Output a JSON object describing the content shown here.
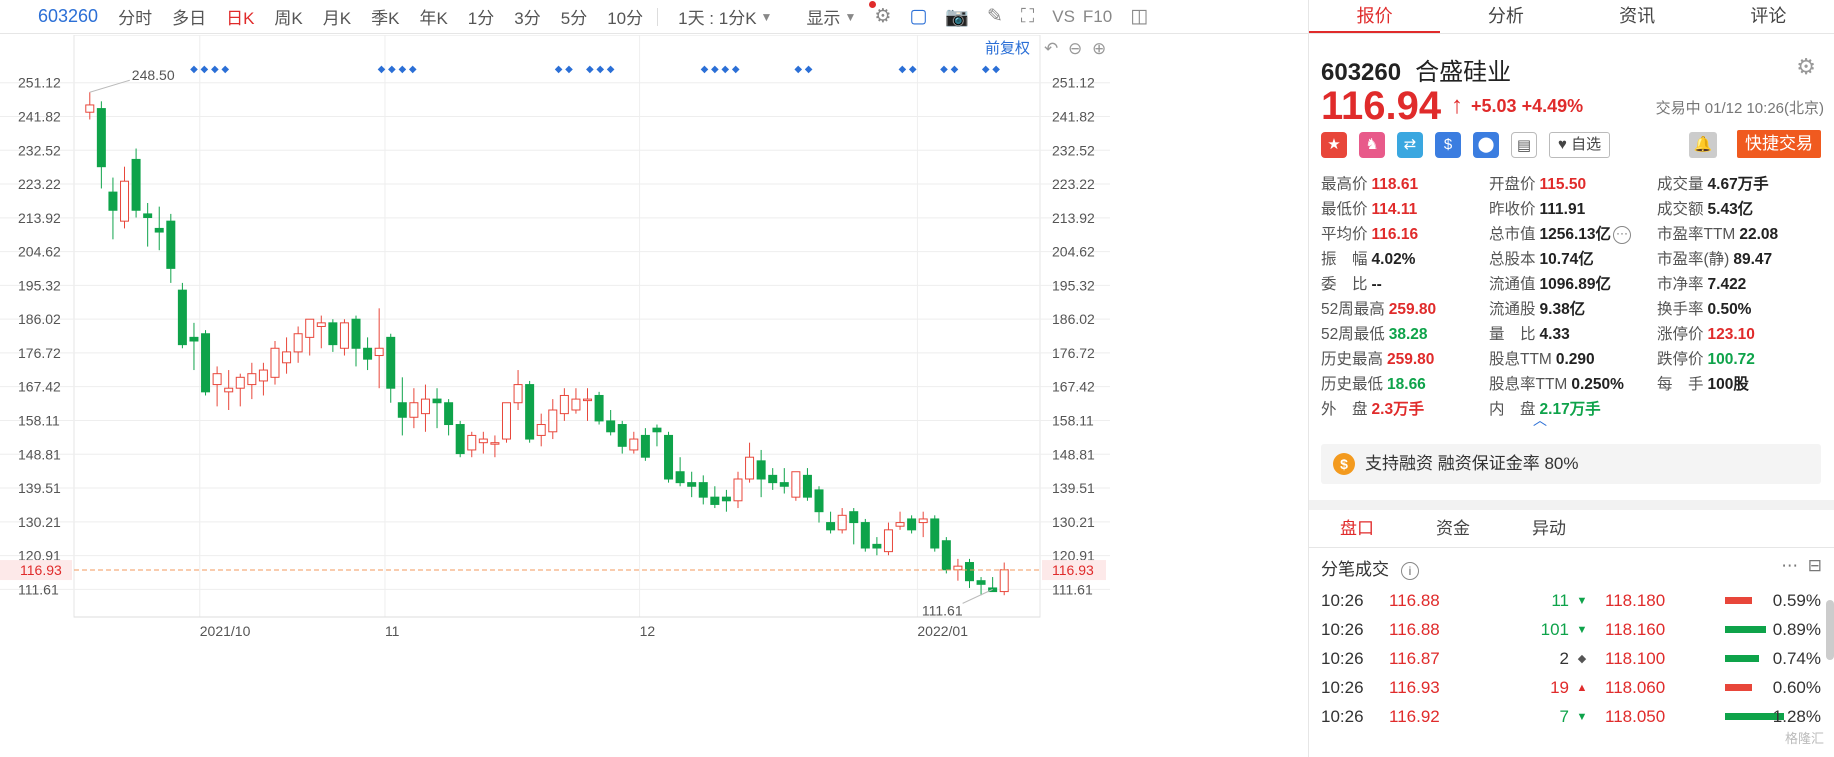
{
  "toolbar": {
    "code": "603260",
    "items": [
      "分时",
      "多日",
      "日K",
      "周K",
      "月K",
      "季K",
      "年K",
      "1分",
      "3分",
      "5分",
      "10分",
      "1天 : 1分K"
    ],
    "active": "日K",
    "display": "显示",
    "vs": "VS",
    "f10": "F10"
  },
  "chart": {
    "fuquan": "前复权",
    "y_ticks": [
      "251.12",
      "241.82",
      "232.52",
      "223.22",
      "213.92",
      "204.62",
      "195.32",
      "186.02",
      "176.72",
      "167.42",
      "158.11",
      "148.81",
      "139.51",
      "130.21",
      "120.91",
      "111.61"
    ],
    "current_label": "116.93",
    "high_label": "248.50",
    "low_label": "111.61",
    "x_labels": [
      "2021/10",
      "11",
      "12",
      "2022/01"
    ]
  },
  "chart_data": {
    "type": "candlestick",
    "ylim": [
      104,
      256
    ],
    "last_price": 116.93,
    "max_marker": 248.5,
    "min_marker": 111.61,
    "candles": [
      [
        243,
        248.5,
        241,
        245
      ],
      [
        244,
        246,
        222,
        228
      ],
      [
        221,
        225,
        208,
        216
      ],
      [
        213,
        228,
        211,
        224
      ],
      [
        230,
        233,
        214,
        216
      ],
      [
        215,
        218,
        206,
        214
      ],
      [
        211,
        217,
        205,
        210
      ],
      [
        213,
        215,
        196,
        200
      ],
      [
        194,
        196,
        178,
        179
      ],
      [
        181,
        185,
        172,
        180
      ],
      [
        182,
        183,
        165,
        166
      ],
      [
        168,
        173,
        162,
        171
      ],
      [
        166,
        172,
        161,
        167
      ],
      [
        167,
        171,
        162,
        170
      ],
      [
        168,
        174,
        164,
        171
      ],
      [
        169,
        174,
        165,
        172
      ],
      [
        170,
        180,
        168,
        178
      ],
      [
        174,
        181,
        171,
        177
      ],
      [
        177,
        184,
        174,
        182
      ],
      [
        181,
        186,
        176,
        186
      ],
      [
        184,
        187,
        178,
        185
      ],
      [
        185,
        186,
        177,
        179
      ],
      [
        178,
        186,
        176,
        185
      ],
      [
        186,
        187,
        173,
        178
      ],
      [
        178,
        181,
        172,
        175
      ],
      [
        176,
        189,
        167,
        178
      ],
      [
        181,
        182,
        163,
        167
      ],
      [
        163,
        170,
        154,
        159
      ],
      [
        159,
        167,
        156,
        163
      ],
      [
        160,
        168,
        155,
        164
      ],
      [
        164,
        167,
        156,
        163
      ],
      [
        163,
        164,
        154,
        157
      ],
      [
        157,
        158,
        148,
        149
      ],
      [
        150,
        155,
        148,
        154
      ],
      [
        152,
        155,
        149,
        153
      ],
      [
        152,
        154,
        148,
        152
      ],
      [
        153,
        163,
        152,
        163
      ],
      [
        163,
        172,
        161,
        168
      ],
      [
        168,
        169,
        152,
        153
      ],
      [
        154,
        160,
        151,
        157
      ],
      [
        155,
        164,
        153,
        161
      ],
      [
        160,
        167,
        158,
        165
      ],
      [
        161,
        167,
        160,
        164
      ],
      [
        164,
        167,
        158,
        164
      ],
      [
        165,
        166,
        157,
        158
      ],
      [
        158,
        161,
        154,
        155
      ],
      [
        157,
        158,
        149,
        151
      ],
      [
        150,
        155,
        149,
        153
      ],
      [
        154,
        156,
        147,
        148
      ],
      [
        156,
        157,
        151,
        155
      ],
      [
        154,
        155,
        141,
        142
      ],
      [
        144,
        148,
        140,
        141
      ],
      [
        141,
        144,
        137,
        140
      ],
      [
        141,
        143,
        135,
        137
      ],
      [
        137,
        140,
        134,
        135
      ],
      [
        137,
        139,
        133,
        136
      ],
      [
        136,
        144,
        134,
        142
      ],
      [
        142,
        152,
        141,
        148
      ],
      [
        147,
        150,
        137,
        142
      ],
      [
        143,
        145,
        139,
        141
      ],
      [
        141,
        145,
        138,
        140
      ],
      [
        137,
        144,
        136,
        144
      ],
      [
        143,
        145,
        136,
        137
      ],
      [
        139,
        140,
        130,
        133
      ],
      [
        130,
        133,
        127,
        128
      ],
      [
        128,
        134,
        127,
        132
      ],
      [
        133,
        134,
        124,
        130
      ],
      [
        130,
        131,
        122,
        123
      ],
      [
        124,
        126,
        121,
        123
      ],
      [
        122,
        130,
        121,
        128
      ],
      [
        129,
        133,
        128,
        130
      ],
      [
        131,
        132,
        127,
        128
      ],
      [
        130,
        133,
        126,
        131
      ],
      [
        131,
        132,
        122,
        123
      ],
      [
        125,
        126,
        116,
        117
      ],
      [
        117,
        120,
        114,
        118
      ],
      [
        119,
        120,
        112,
        114
      ],
      [
        114,
        115,
        110,
        113
      ],
      [
        112,
        115,
        111,
        111
      ],
      [
        111,
        119,
        110,
        117
      ]
    ]
  },
  "tabs": [
    "报价",
    "分析",
    "资讯",
    "评论"
  ],
  "quote": {
    "code": "603260",
    "name": "合盛硅业",
    "price": "116.94",
    "change": "+5.03",
    "change_pct": "+4.49%",
    "status": "交易中 01/12 10:26(北京)",
    "fav": "自选",
    "quick_trade": "快捷交易",
    "rows": [
      [
        [
          "最高价",
          "118.61",
          "red"
        ],
        [
          "开盘价",
          "115.50",
          "red"
        ],
        [
          "成交量",
          "4.67万手",
          "dark"
        ]
      ],
      [
        [
          "最低价",
          "114.11",
          "red"
        ],
        [
          "昨收价",
          "111.91",
          "dark"
        ],
        [
          "成交额",
          "5.43亿",
          "dark"
        ]
      ],
      [
        [
          "平均价",
          "116.16",
          "red"
        ],
        [
          "总市值",
          "1256.13亿",
          "dark"
        ],
        [
          "市盈率TTM",
          "22.08",
          "dark"
        ]
      ],
      [
        [
          "振　幅",
          "4.02%",
          "dark"
        ],
        [
          "总股本",
          "10.74亿",
          "dark"
        ],
        [
          "市盈率(静)",
          "89.47",
          "dark"
        ]
      ],
      [
        [
          "委　比",
          "--",
          "dark"
        ],
        [
          "流通值",
          "1096.89亿",
          "dark"
        ],
        [
          "市净率",
          "7.422",
          "dark"
        ]
      ],
      [
        [
          "52周最高",
          "259.80",
          "red"
        ],
        [
          "流通股",
          "9.38亿",
          "dark"
        ],
        [
          "换手率",
          "0.50%",
          "dark"
        ]
      ],
      [
        [
          "52周最低",
          "38.28",
          "green"
        ],
        [
          "量　比",
          "4.33",
          "dark"
        ],
        [
          "涨停价",
          "123.10",
          "red"
        ]
      ],
      [
        [
          "历史最高",
          "259.80",
          "red"
        ],
        [
          "股息TTM",
          "0.290",
          "dark"
        ],
        [
          "跌停价",
          "100.72",
          "green"
        ]
      ],
      [
        [
          "历史最低",
          "18.66",
          "green"
        ],
        [
          "股息率TTM",
          "0.250%",
          "dark"
        ],
        [
          "每　手",
          "100股",
          "dark"
        ]
      ],
      [
        [
          "外　盘",
          "2.3万手",
          "red"
        ],
        [
          "内　盘",
          "2.17万手",
          "green"
        ],
        [
          "",
          ""
        ]
      ]
    ],
    "margin_text": "支持融资 融资保证金率 80%"
  },
  "subtabs": [
    "盘口",
    "资金",
    "异动"
  ],
  "ticks": {
    "title": "分笔成交",
    "rows": [
      {
        "time": "10:26",
        "price": "116.88",
        "vol": "11",
        "dir": "down",
        "price2": "118.180",
        "pct": "0.59%",
        "bar": "red",
        "barw": 0.3
      },
      {
        "time": "10:26",
        "price": "116.88",
        "vol": "101",
        "dir": "down",
        "price2": "118.160",
        "pct": "0.89%",
        "bar": "green",
        "barw": 0.45
      },
      {
        "time": "10:26",
        "price": "116.87",
        "vol": "2",
        "dir": "none",
        "price2": "118.100",
        "pct": "0.74%",
        "bar": "green",
        "barw": 0.38
      },
      {
        "time": "10:26",
        "price": "116.93",
        "vol": "19",
        "dir": "up",
        "price2": "118.060",
        "pct": "0.60%",
        "bar": "red",
        "barw": 0.3
      },
      {
        "time": "10:26",
        "price": "116.92",
        "vol": "7",
        "dir": "down",
        "price2": "118.050",
        "pct": "1.28%",
        "bar": "green",
        "barw": 0.65
      }
    ]
  },
  "watermark": "格隆汇"
}
